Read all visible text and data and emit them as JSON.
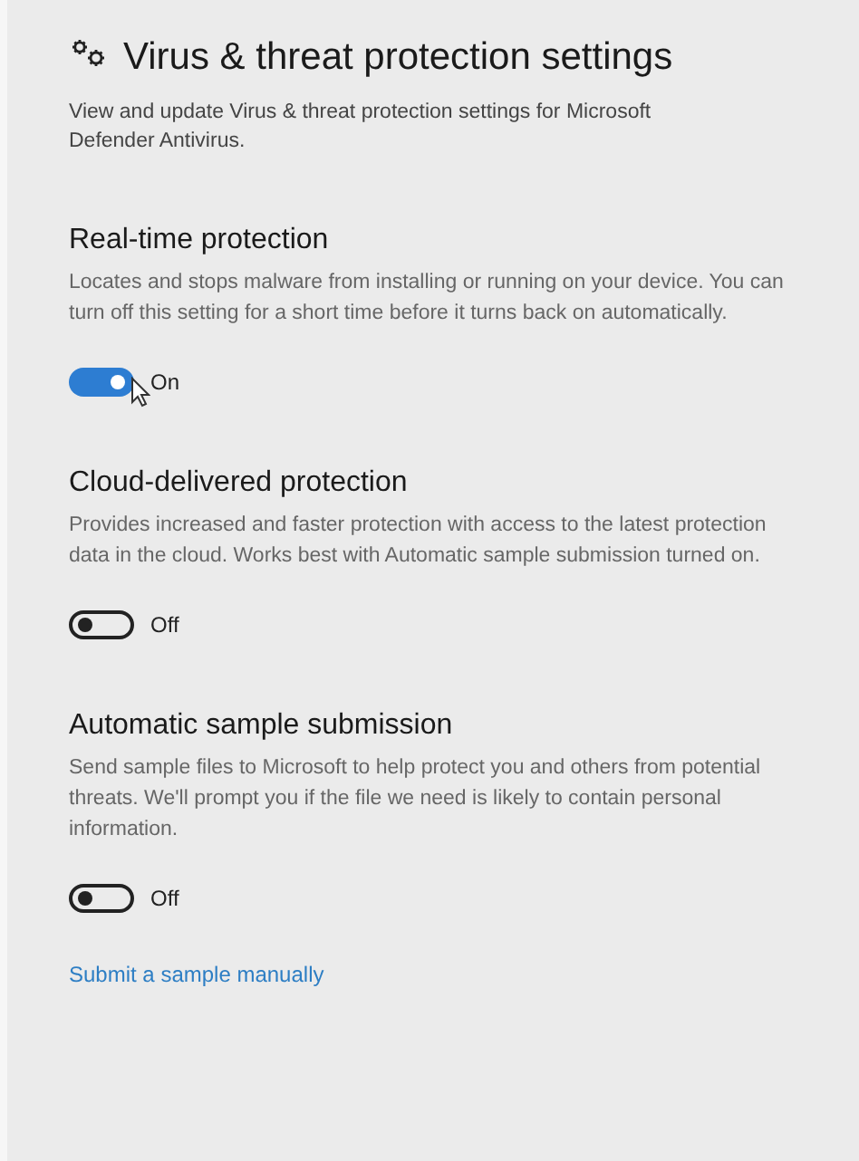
{
  "title": "Virus & threat protection settings",
  "description": "View and update Virus & threat protection settings for Microsoft Defender Antivirus.",
  "sections": [
    {
      "heading": "Real-time protection",
      "text": "Locates and stops malware from installing or running on your device. You can turn off this setting for a short time before it turns back on automatically.",
      "toggle": {
        "on": true,
        "label": "On"
      },
      "cursor": true
    },
    {
      "heading": "Cloud-delivered protection",
      "text": "Provides increased and faster protection with access to the latest protection data in the cloud. Works best with Automatic sample submission turned on.",
      "toggle": {
        "on": false,
        "label": "Off"
      },
      "cursor": false
    },
    {
      "heading": "Automatic sample submission",
      "text": "Send sample files to Microsoft to help protect you and others from potential threats. We'll prompt you if the file we need is likely to contain personal information.",
      "toggle": {
        "on": false,
        "label": "Off"
      },
      "cursor": false
    }
  ],
  "link": "Submit a sample manually"
}
